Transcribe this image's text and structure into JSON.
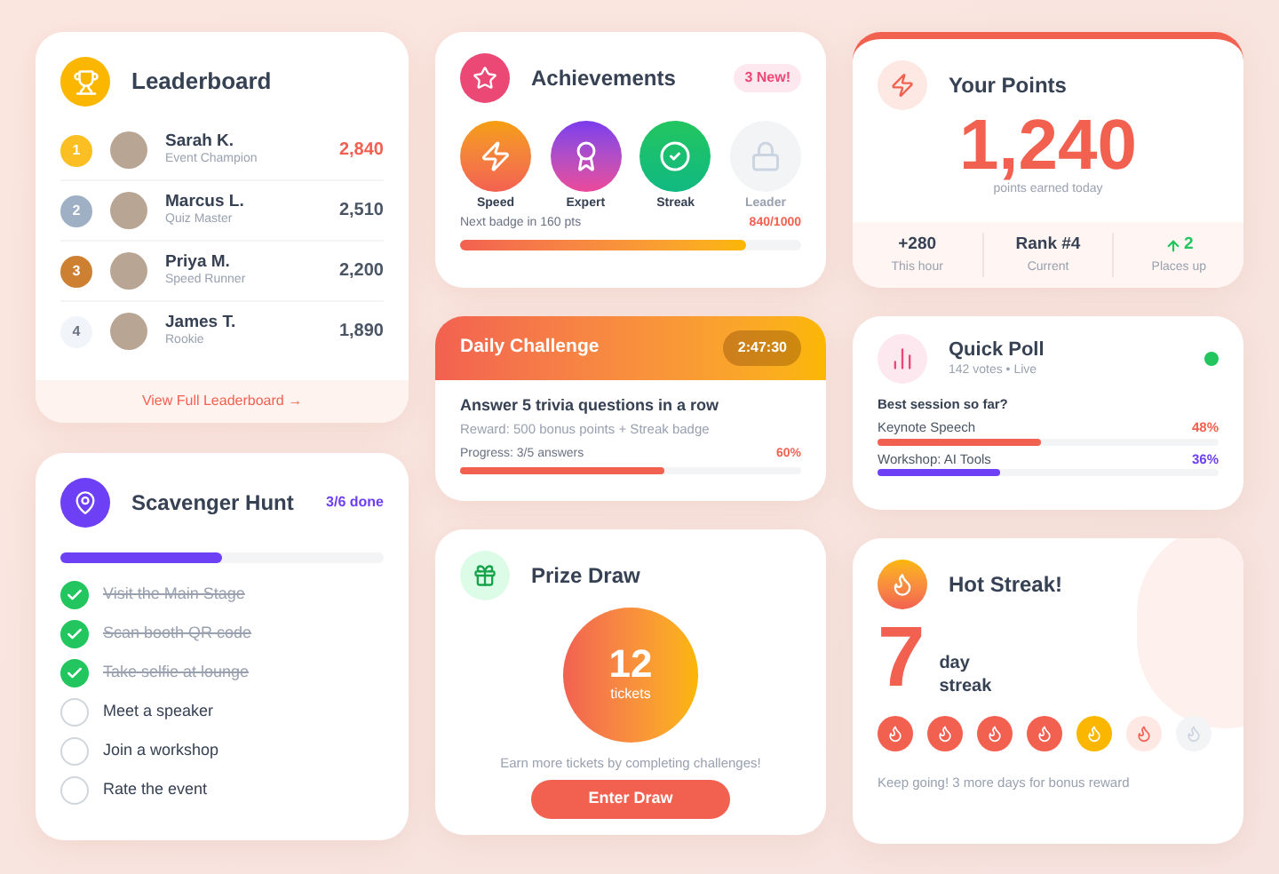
{
  "leaderboard": {
    "title": "Leaderboard",
    "players": [
      {
        "rank": "1",
        "name": "Sarah K.",
        "role": "Event Champion",
        "score": "2,840",
        "color": "#fbbf24",
        "highlight": true
      },
      {
        "rank": "2",
        "name": "Marcus L.",
        "role": "Quiz Master",
        "score": "2,510",
        "color": "#9fb0c4",
        "highlight": false
      },
      {
        "rank": "3",
        "name": "Priya M.",
        "role": "Speed Runner",
        "score": "2,200",
        "color": "#cd7f32",
        "highlight": false
      },
      {
        "rank": "4",
        "name": "James T.",
        "role": "Rookie",
        "score": "1,890",
        "color": "#f1f5f9",
        "highlight": false
      }
    ],
    "link": "View Full Leaderboard →"
  },
  "scavenger": {
    "title": "Scavenger Hunt",
    "count": "3/6 done",
    "level": 0.5,
    "tasks": [
      {
        "label": "Visit the Main Stage",
        "checked": true
      },
      {
        "label": "Scan booth QR code",
        "checked": true
      },
      {
        "label": "Take selfie at lounge",
        "checked": true
      },
      {
        "label": "Meet a speaker",
        "checked": false
      },
      {
        "label": "Join a workshop",
        "checked": false
      },
      {
        "label": "Rate the event",
        "checked": false
      }
    ]
  },
  "achievements": {
    "title": "Achievements",
    "badge": "3 New!",
    "badges": [
      {
        "kind": "bolt",
        "label": "Speed",
        "unlocked": true
      },
      {
        "kind": "award",
        "label": "Expert",
        "unlocked": true
      },
      {
        "kind": "check",
        "label": "Streak",
        "unlocked": true
      },
      {
        "kind": "lock",
        "label": "Leader",
        "unlocked": false
      }
    ],
    "next": "Next badge in 160 pts",
    "progress": "840/1000",
    "level": 0.84
  },
  "challenge": {
    "title": "Daily Challenge",
    "timer": "2:47:30",
    "task": "Answer 5 trivia questions in a row",
    "reward": "Reward: 500 bonus points + Streak badge",
    "progress": "Progress: 3/5 answers",
    "percent": "60%",
    "level": 0.6
  },
  "prize": {
    "title": "Prize Draw",
    "count": "12",
    "unit": "tickets",
    "hint": "Earn more tickets by completing challenges!",
    "button": "Enter Draw"
  },
  "points": {
    "title": "Your Points",
    "value": "1,240",
    "caption": "points earned today",
    "stats": [
      {
        "kind": "plain",
        "value": "+280",
        "label": "This hour"
      },
      {
        "kind": "plain",
        "value": "Rank #4",
        "label": "Current"
      },
      {
        "kind": "up",
        "value": "2",
        "label": "Places up"
      }
    ]
  },
  "poll": {
    "title": "Quick Poll",
    "meta": "142 votes • Live",
    "live": true,
    "question": "Best session so far?",
    "options": [
      {
        "label": "Keynote Speech",
        "percent": "48%",
        "level": 0.48,
        "color": "#f26150"
      },
      {
        "label": "Workshop: AI Tools",
        "percent": "36%",
        "level": 0.36,
        "color": "#6d3ff5"
      }
    ]
  },
  "streak": {
    "title": "Hot Streak!",
    "days": "7",
    "unit": "day streak",
    "flames": [
      {
        "kind": "done"
      },
      {
        "kind": "done"
      },
      {
        "kind": "done"
      },
      {
        "kind": "done"
      },
      {
        "kind": "today"
      },
      {
        "kind": "next"
      },
      {
        "kind": "locked"
      }
    ],
    "hint": "Keep going! 3 more days for bonus reward"
  }
}
